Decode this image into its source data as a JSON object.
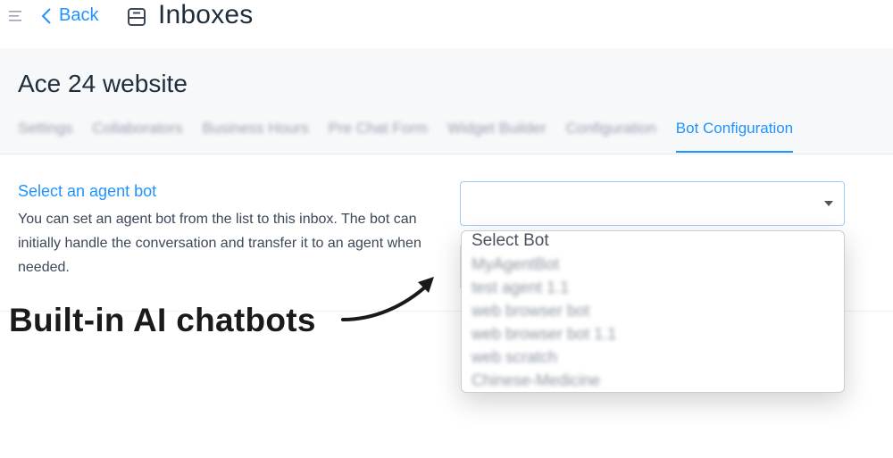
{
  "topbar": {
    "back_label": "Back",
    "title": "Inboxes"
  },
  "header": {
    "inbox_name": "Ace 24 website",
    "tabs": [
      {
        "label": "Settings"
      },
      {
        "label": "Collaborators"
      },
      {
        "label": "Business Hours"
      },
      {
        "label": "Pre Chat Form"
      },
      {
        "label": "Widget Builder"
      },
      {
        "label": "Configuration"
      },
      {
        "label": "Bot Configuration",
        "active": true
      }
    ]
  },
  "bot_section": {
    "title": "Select an agent bot",
    "description": "You can set an agent bot from the list to this inbox. The bot can initially handle the conversation and transfer it to an agent when needed.",
    "select_value": "",
    "options": [
      "Select Bot",
      "MyAgentBot",
      "test agent 1.1",
      "web browser bot",
      "web browser bot 1.1",
      "web scratch",
      "Chinese-Medicine"
    ]
  },
  "annotation": {
    "text": "Built-in AI chatbots"
  },
  "colors": {
    "accent": "#1f93ff",
    "text": "#1f2d3d",
    "header_bg": "#f7f8fa"
  },
  "icons": [
    "menu-icon",
    "chevron-left-icon",
    "inbox-icon",
    "caret-down-icon",
    "arrow-icon"
  ]
}
